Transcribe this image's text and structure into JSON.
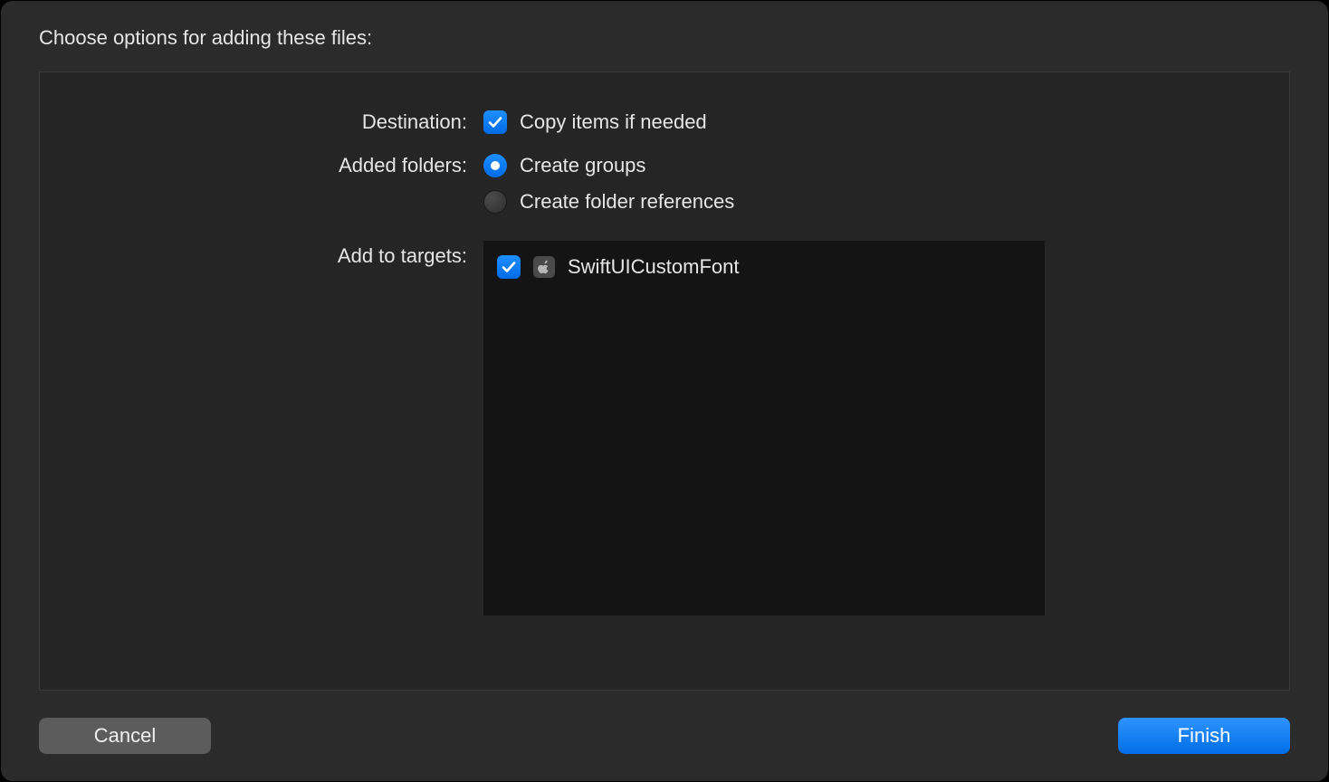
{
  "title": "Choose options for adding these files:",
  "destination": {
    "label": "Destination:",
    "copy_items": {
      "label": "Copy items if needed",
      "checked": true
    }
  },
  "added_folders": {
    "label": "Added folders:",
    "options": {
      "create_groups": {
        "label": "Create groups",
        "selected": true
      },
      "create_folder_references": {
        "label": "Create folder references",
        "selected": false
      }
    }
  },
  "add_to_targets": {
    "label": "Add to targets:",
    "items": [
      {
        "name": "SwiftUICustomFont",
        "checked": true
      }
    ]
  },
  "buttons": {
    "cancel": "Cancel",
    "finish": "Finish"
  }
}
